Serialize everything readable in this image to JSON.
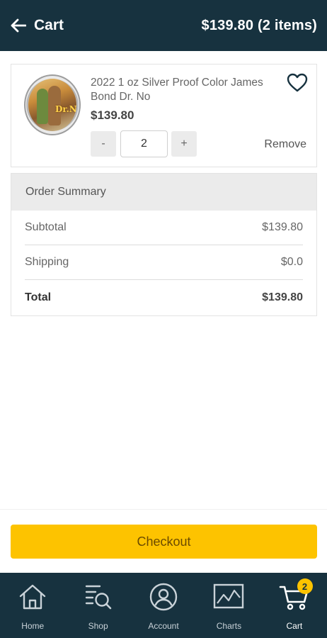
{
  "header": {
    "title": "Cart",
    "total": "$139.80 (2 items)"
  },
  "cart": {
    "items": [
      {
        "title": "2022 1 oz Silver Proof Color James Bond Dr. No",
        "price": "$139.80",
        "quantity": "2",
        "minus_label": "-",
        "plus_label": "+",
        "remove_label": "Remove",
        "coin_text": "Dr.No"
      }
    ]
  },
  "summary": {
    "title": "Order Summary",
    "rows": [
      {
        "label": "Subtotal",
        "value": "$139.80"
      },
      {
        "label": "Shipping",
        "value": "$0.0"
      },
      {
        "label": "Total",
        "value": "$139.80"
      }
    ]
  },
  "checkout": {
    "label": "Checkout"
  },
  "nav": {
    "items": [
      {
        "label": "Home",
        "icon": "home-icon"
      },
      {
        "label": "Shop",
        "icon": "shop-search-icon"
      },
      {
        "label": "Account",
        "icon": "account-icon"
      },
      {
        "label": "Charts",
        "icon": "chart-icon"
      },
      {
        "label": "Cart",
        "icon": "cart-icon",
        "badge": "2",
        "active": true
      }
    ]
  },
  "colors": {
    "header_bg": "#17323f",
    "accent": "#fdc300",
    "summary_header_bg": "#ebebeb"
  }
}
